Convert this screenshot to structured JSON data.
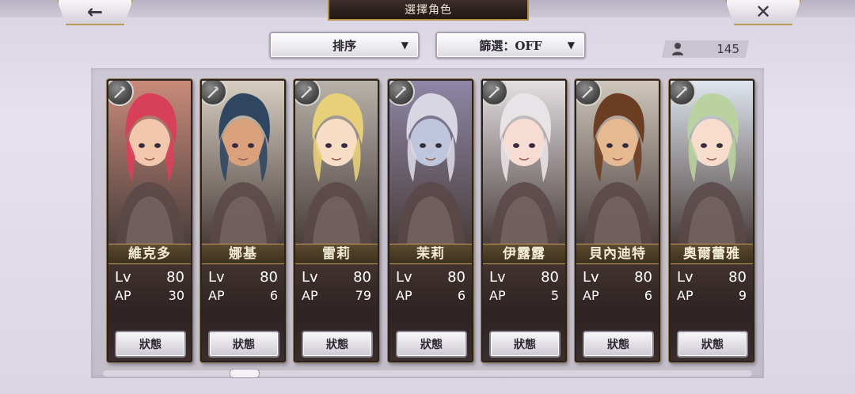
{
  "header": {
    "title": "選擇角色",
    "back_icon": "←",
    "close_icon": "✕"
  },
  "toolbar": {
    "sort_label": "排序",
    "filter_label": "篩選：OFF",
    "arrow": "▼",
    "character_count": "145"
  },
  "characters": [
    {
      "name": "維克多",
      "lv_label": "Lv",
      "lv": "80",
      "ap_label": "AP",
      "ap": "30",
      "status_label": "狀態",
      "hair": "#d8405a",
      "bg": "#c98a7a",
      "skin": "#f2c7ae"
    },
    {
      "name": "娜基",
      "lv_label": "Lv",
      "lv": "80",
      "ap_label": "AP",
      "ap": "6",
      "status_label": "狀態",
      "hair": "#2f4660",
      "bg": "#d8cfc2",
      "skin": "#d9a27c"
    },
    {
      "name": "雷莉",
      "lv_label": "Lv",
      "lv": "80",
      "ap_label": "AP",
      "ap": "79",
      "status_label": "狀態",
      "hair": "#e8cf7a",
      "bg": "#b8b2aa",
      "skin": "#f7dcc6"
    },
    {
      "name": "茉莉",
      "lv_label": "Lv",
      "lv": "80",
      "ap_label": "AP",
      "ap": "6",
      "status_label": "狀態",
      "hair": "#d8d6e2",
      "bg": "#8e86a6",
      "skin": "#bfc5dc"
    },
    {
      "name": "伊露露",
      "lv_label": "Lv",
      "lv": "80",
      "ap_label": "AP",
      "ap": "5",
      "status_label": "狀態",
      "hair": "#e7e3e6",
      "bg": "#e4dfe2",
      "skin": "#f6dcd2"
    },
    {
      "name": "貝內迪特",
      "lv_label": "Lv",
      "lv": "80",
      "ap_label": "AP",
      "ap": "6",
      "status_label": "狀態",
      "hair": "#6b3e24",
      "bg": "#cfc6bc",
      "skin": "#e7b990"
    },
    {
      "name": "奧爾蕾雅",
      "lv_label": "Lv",
      "lv": "80",
      "ap_label": "AP",
      "ap": "9",
      "status_label": "狀態",
      "hair": "#b9d2a0",
      "bg": "#dfe6ee",
      "skin": "#f8ddcc"
    }
  ]
}
